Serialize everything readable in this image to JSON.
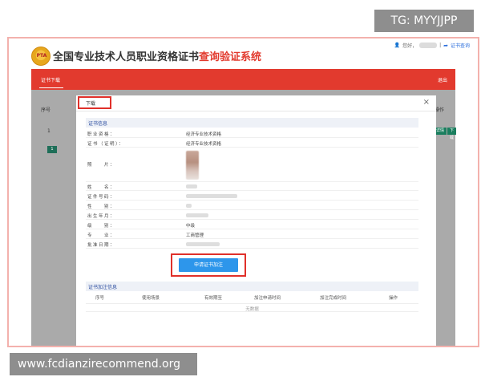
{
  "watermarks": {
    "top": "TG: MYYJJPP",
    "bottom": "www.fcdianzirecommend.org"
  },
  "header": {
    "logo_text": "PTA",
    "title_main": "全国专业技术人员职业资格证书",
    "title_accent": "查询验证系统",
    "greeting": "您好，",
    "cert_query": "证书查询"
  },
  "nav": {
    "tab_label": "证书下载",
    "exit_label": "退出"
  },
  "background": {
    "col_seq": "序号",
    "row_one": "1",
    "page_num": "1",
    "col_op": "操作",
    "btn_detail": "证书详情",
    "btn_download": "下载"
  },
  "modal": {
    "title": "下载",
    "close": "×",
    "section_info": "证书信息",
    "rows": [
      {
        "label": "职业资格：",
        "value": "经济专业技术资格"
      },
      {
        "label": "证书（证明）：",
        "value": "经济专业技术资格"
      },
      {
        "label": "照　　片：",
        "value": ""
      },
      {
        "label": "姓　　名：",
        "value": ""
      },
      {
        "label": "证件号码：",
        "value": ""
      },
      {
        "label": "性　　别：",
        "value": ""
      },
      {
        "label": "出生年月：",
        "value": ""
      },
      {
        "label": "级　　别：",
        "value": "中级"
      },
      {
        "label": "专　　业：",
        "value": "工商管理"
      },
      {
        "label": "批准日期：",
        "value": ""
      }
    ],
    "apply_button": "申请证书加注",
    "section_annotation": "证书加注信息",
    "table_headers": [
      "序号",
      "使用场景",
      "有效期至",
      "加注申请时间",
      "加注完成时间",
      "操作"
    ],
    "empty_text": "无数据"
  },
  "colors": {
    "brand_red": "#e23a2e",
    "link_blue": "#2d6fdc",
    "primary_button": "#2d96eb",
    "highlight_box": "#e0302a"
  }
}
